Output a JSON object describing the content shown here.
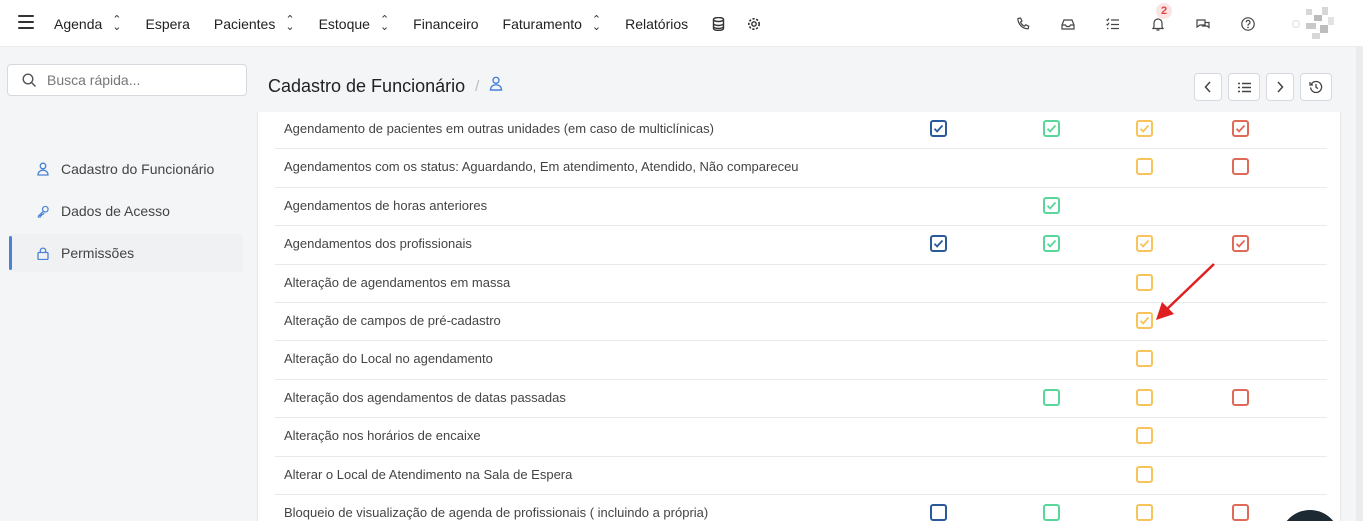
{
  "nav": {
    "items": [
      {
        "label": "Agenda",
        "caret": true
      },
      {
        "label": "Espera",
        "caret": false
      },
      {
        "label": "Pacientes",
        "caret": true
      },
      {
        "label": "Estoque",
        "caret": true
      },
      {
        "label": "Financeiro",
        "caret": false
      },
      {
        "label": "Faturamento",
        "caret": true
      },
      {
        "label": "Relatórios",
        "caret": false
      }
    ],
    "notification_count": "2"
  },
  "search": {
    "placeholder": "Busca rápida..."
  },
  "sidebar": {
    "items": [
      {
        "label": "Cadastro do Funcionário",
        "icon": "user-icon",
        "active": false
      },
      {
        "label": "Dados de Acesso",
        "icon": "key-icon",
        "active": false
      },
      {
        "label": "Permissões",
        "icon": "lock-icon",
        "active": true
      }
    ]
  },
  "header": {
    "title": "Cadastro de Funcionário",
    "separator": "/"
  },
  "permission_rows": [
    {
      "label": "Agendamento de pacientes em outras unidades (em caso de multiclínicas)",
      "c1": "checked",
      "c2": "checked",
      "c3": "checked",
      "c4": "checked"
    },
    {
      "label": "Agendamentos com os status: Aguardando, Em atendimento, Atendido, Não compareceu",
      "c1": "none",
      "c2": "none",
      "c3": "empty",
      "c4": "empty"
    },
    {
      "label": "Agendamentos de horas anteriores",
      "c1": "none",
      "c2": "checked",
      "c3": "none",
      "c4": "none"
    },
    {
      "label": "Agendamentos dos profissionais",
      "c1": "checked",
      "c2": "checked",
      "c3": "checked",
      "c4": "checked"
    },
    {
      "label": "Alteração de agendamentos em massa",
      "c1": "none",
      "c2": "none",
      "c3": "empty",
      "c4": "none"
    },
    {
      "label": "Alteração de campos de pré-cadastro",
      "c1": "none",
      "c2": "none",
      "c3": "checked",
      "c4": "none"
    },
    {
      "label": "Alteração do Local no agendamento",
      "c1": "none",
      "c2": "none",
      "c3": "empty",
      "c4": "none"
    },
    {
      "label": "Alteração dos agendamentos de datas passadas",
      "c1": "none",
      "c2": "empty",
      "c3": "empty",
      "c4": "empty"
    },
    {
      "label": "Alteração nos horários de encaixe",
      "c1": "none",
      "c2": "none",
      "c3": "empty",
      "c4": "none"
    },
    {
      "label": "Alterar o Local de Atendimento na Sala de Espera",
      "c1": "none",
      "c2": "none",
      "c3": "empty",
      "c4": "none"
    },
    {
      "label": "Bloqueio de visualização de agenda de profissionais ( incluindo a própria)",
      "c1": "empty",
      "c2": "empty",
      "c3": "empty",
      "c4": "empty"
    }
  ],
  "colors": {
    "col1": "#2b5a9a",
    "col2": "#5ad69b",
    "col3": "#f7c35b",
    "col4": "#e06a58",
    "accent": "#4a82d6",
    "annotation_arrow": "#e02020"
  }
}
